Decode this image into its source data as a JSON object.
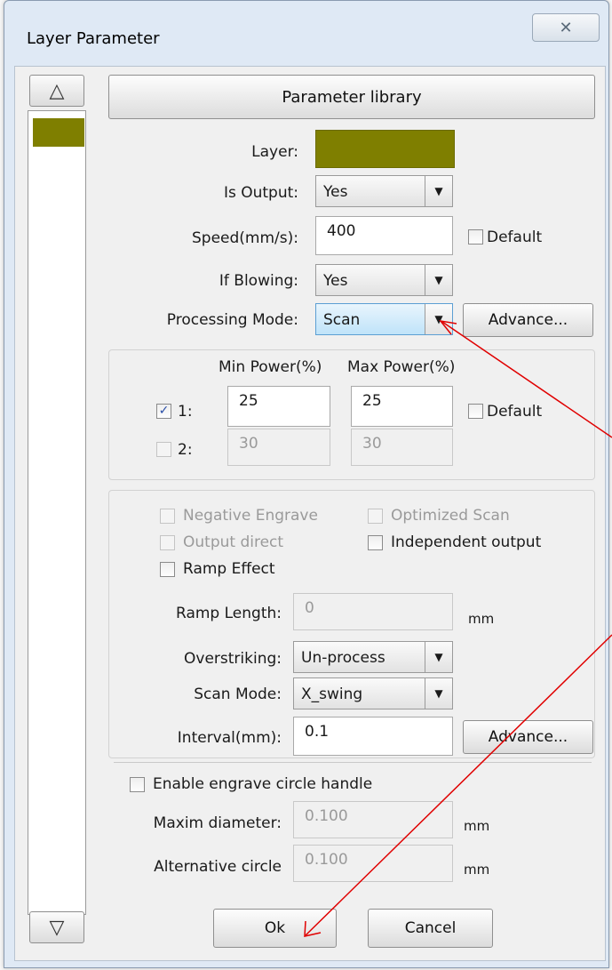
{
  "window": {
    "title": "Layer Parameter",
    "close_glyph": "✕"
  },
  "layer_strip": {
    "up_glyph": "△",
    "down_glyph": "▽",
    "layer_color": "#7f7f00"
  },
  "library_button": "Parameter library",
  "fields": {
    "layer_label": "Layer:",
    "is_output_label": "Is Output:",
    "is_output_value": "Yes",
    "speed_label": "Speed(mm/s):",
    "speed_value": "400",
    "default_label": "Default",
    "if_blowing_label": "If Blowing:",
    "if_blowing_value": "Yes",
    "processing_mode_label": "Processing Mode:",
    "processing_mode_value": "Scan",
    "advance_label": "Advance..."
  },
  "power": {
    "min_header": "Min Power(%)",
    "max_header": "Max Power(%)",
    "row1_label": "1:",
    "row1_min": "25",
    "row1_max": "25",
    "row1_checked": true,
    "row2_label": "2:",
    "row2_min": "30",
    "row2_max": "30",
    "row2_checked": false,
    "default_label": "Default"
  },
  "scan": {
    "negative_engrave": "Negative Engrave",
    "optimized_scan": "Optimized Scan",
    "output_direct": "Output direct",
    "independent_output": "Independent output",
    "ramp_effect": "Ramp Effect",
    "ramp_length_label": "Ramp Length:",
    "ramp_length_value": "0",
    "unit_mm": "mm",
    "overstriking_label": "Overstriking:",
    "overstriking_value": "Un-process",
    "scan_mode_label": "Scan Mode:",
    "scan_mode_value": "X_swing",
    "interval_label": "Interval(mm):",
    "interval_value": "0.1",
    "advance_label": "Advance..."
  },
  "circle": {
    "enable_label": "Enable engrave circle handle",
    "max_diameter_label": "Maxim diameter:",
    "max_diameter_value": "0.100",
    "alt_circle_label": "Alternative circle",
    "alt_circle_value": "0.100",
    "unit_mm": "mm"
  },
  "footer": {
    "ok_label": "Ok",
    "cancel_label": "Cancel"
  },
  "annotation_color": "#e00000"
}
